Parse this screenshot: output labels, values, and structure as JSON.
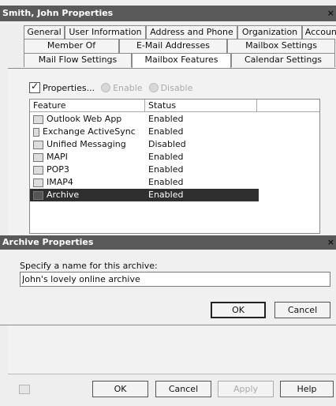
{
  "window": {
    "title": "Smith, John Properties",
    "close": "×"
  },
  "tabs": {
    "row1": [
      "General",
      "User Information",
      "Address and Phone",
      "Organization",
      "Account"
    ],
    "row2": [
      "Member Of",
      "E-Mail Addresses",
      "Mailbox Settings"
    ],
    "row3": [
      "Mail Flow Settings",
      "Mailbox Features",
      "Calendar Settings"
    ],
    "active": "Mailbox Features"
  },
  "toolbar": {
    "properties": "Properties...",
    "enable": "Enable",
    "disable": "Disable"
  },
  "list": {
    "columns": [
      "Feature",
      "Status"
    ],
    "rows": [
      {
        "feature": "Outlook Web App",
        "status": "Enabled",
        "icon": "owa-icon"
      },
      {
        "feature": "Exchange ActiveSync",
        "status": "Enabled",
        "icon": "activesync-icon"
      },
      {
        "feature": "Unified Messaging",
        "status": "Disabled",
        "icon": "unified-messaging-icon"
      },
      {
        "feature": "MAPI",
        "status": "Enabled",
        "icon": "mapi-icon"
      },
      {
        "feature": "POP3",
        "status": "Enabled",
        "icon": "pop3-icon"
      },
      {
        "feature": "IMAP4",
        "status": "Enabled",
        "icon": "imap4-icon"
      },
      {
        "feature": "Archive",
        "status": "Enabled",
        "icon": "archive-icon",
        "selected": true
      }
    ]
  },
  "archive_dialog": {
    "title": "Archive Properties",
    "close": "×",
    "label": "Specify a name for this archive:",
    "value": "John's lovely online archive",
    "ok": "OK",
    "cancel": "Cancel"
  },
  "footer": {
    "ok": "OK",
    "cancel": "Cancel",
    "apply": "Apply",
    "help": "Help"
  }
}
